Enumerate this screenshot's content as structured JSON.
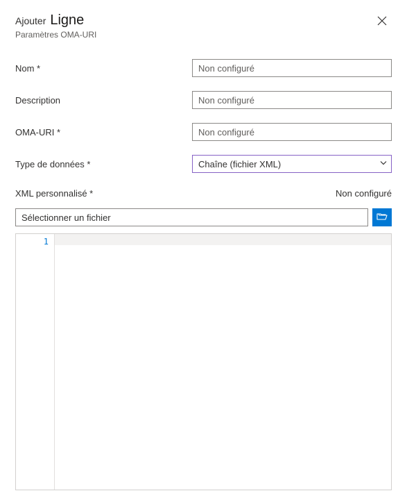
{
  "header": {
    "title_prefix": "Ajouter",
    "title_main": "Ligne",
    "subtitle": "Paramètres OMA-URI"
  },
  "fields": {
    "name": {
      "label": "Nom *",
      "placeholder": "Non configuré",
      "value": ""
    },
    "description": {
      "label": "Description",
      "placeholder": "Non configuré",
      "value": ""
    },
    "omauri": {
      "label": "OMA-URI *",
      "placeholder": "Non configuré",
      "value": ""
    },
    "datatype": {
      "label": "Type de données *",
      "selected": "Chaîne (fichier XML)"
    }
  },
  "xml_section": {
    "label": "XML personnalisé *",
    "status": "Non configuré",
    "file_placeholder": "Sélectionner un fichier",
    "file_value": ""
  },
  "editor": {
    "line_number": "1",
    "content": ""
  }
}
